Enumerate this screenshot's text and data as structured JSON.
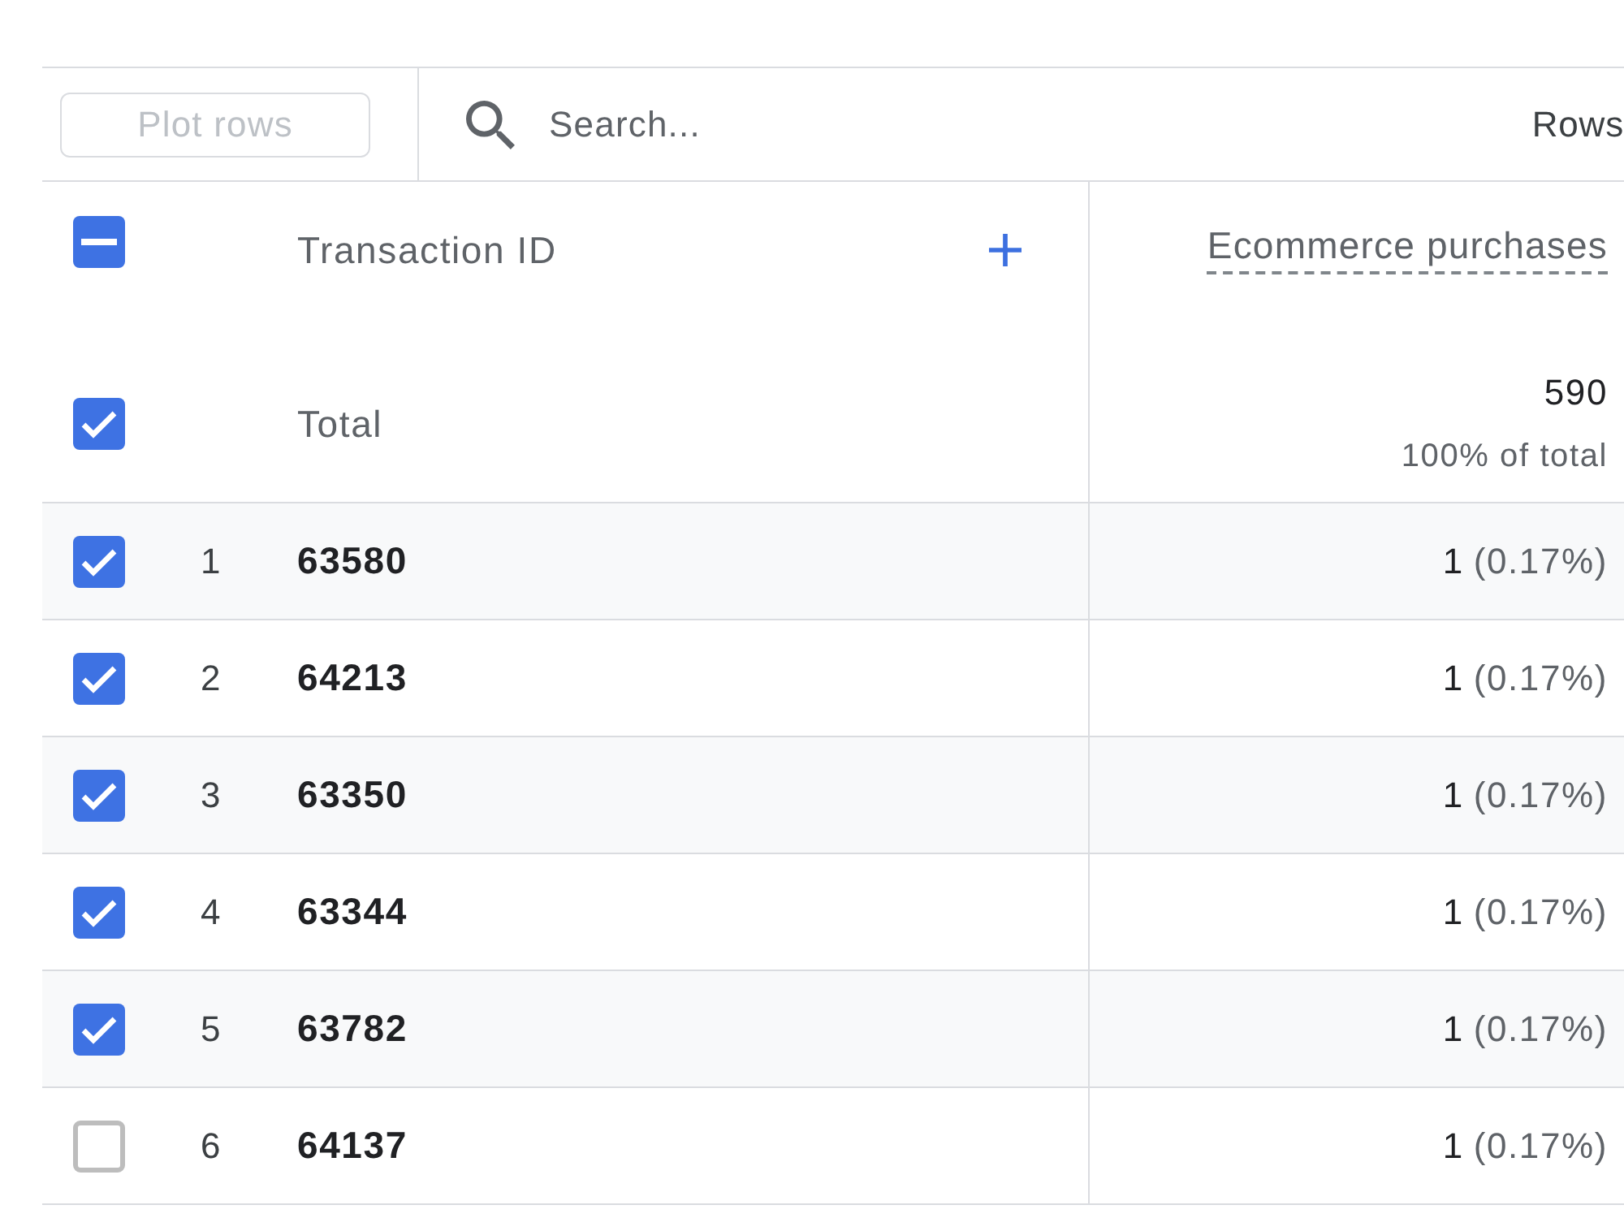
{
  "toolbar": {
    "plot_button": {
      "label": "Plot rows",
      "disabled": true
    },
    "search": {
      "placeholder": "Search..."
    },
    "rows_label": "Rows"
  },
  "table": {
    "header_checkbox": {
      "indeterminate": true
    },
    "columns": [
      {
        "label": "Transaction ID",
        "kind": "dimension"
      },
      {
        "label": "Ecommerce purchases",
        "kind": "metric"
      }
    ],
    "total": {
      "checked": true,
      "label": "Total",
      "value": "590",
      "share": "100% of total"
    },
    "rows": [
      {
        "checked": true,
        "index": "1",
        "transaction_id": "63580",
        "value": "1",
        "share": "(0.17%)"
      },
      {
        "checked": true,
        "index": "2",
        "transaction_id": "64213",
        "value": "1",
        "share": "(0.17%)"
      },
      {
        "checked": true,
        "index": "3",
        "transaction_id": "63350",
        "value": "1",
        "share": "(0.17%)"
      },
      {
        "checked": true,
        "index": "4",
        "transaction_id": "63344",
        "value": "1",
        "share": "(0.17%)"
      },
      {
        "checked": true,
        "index": "5",
        "transaction_id": "63782",
        "value": "1",
        "share": "(0.17%)"
      },
      {
        "checked": false,
        "index": "6",
        "transaction_id": "64137",
        "value": "1",
        "share": "(0.17%)"
      }
    ]
  }
}
